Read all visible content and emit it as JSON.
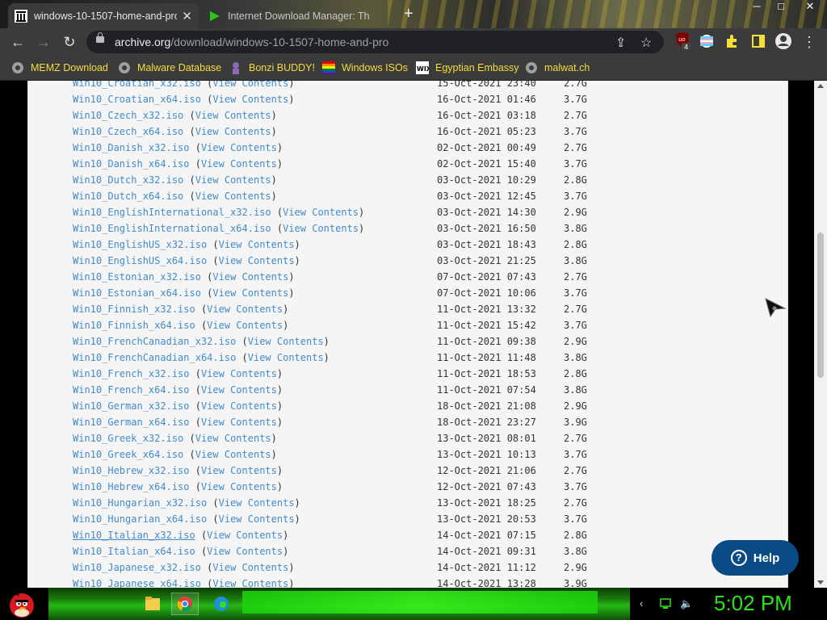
{
  "tabs": [
    {
      "title": "windows-10-1507-home-and-pro",
      "active": true
    },
    {
      "title": "Internet Download Manager: Th",
      "active": false
    }
  ],
  "window_controls": {
    "minimize": "─",
    "maximize": "□",
    "close": "✕"
  },
  "address_bar": {
    "host": "archive.org",
    "path": "/download/windows-10-1507-home-and-pro"
  },
  "extension_badge": "4",
  "bookmarks": [
    {
      "label": "MEMZ Download",
      "icon": "globe-icon"
    },
    {
      "label": "Malware Database",
      "icon": "globe-icon"
    },
    {
      "label": "Bonzi BUDDY!",
      "icon": "bonzi-icon"
    },
    {
      "label": "Windows ISOs",
      "icon": "rainbow-icon"
    },
    {
      "label": "Egyptian Embassy",
      "icon": "wix-icon"
    },
    {
      "label": "malwat.ch",
      "icon": "globe-icon"
    }
  ],
  "files": {
    "view_contents_label": "View Contents",
    "rows": [
      {
        "name": "Win10_Croatian_x32.iso",
        "date": "15-Oct-2021 23:40",
        "size": "2.7G"
      },
      {
        "name": "Win10_Croatian_x64.iso",
        "date": "16-Oct-2021 01:46",
        "size": "3.7G"
      },
      {
        "name": "Win10_Czech_x32.iso",
        "date": "16-Oct-2021 03:18",
        "size": "2.7G"
      },
      {
        "name": "Win10_Czech_x64.iso",
        "date": "16-Oct-2021 05:23",
        "size": "3.7G"
      },
      {
        "name": "Win10_Danish_x32.iso",
        "date": "02-Oct-2021 00:49",
        "size": "2.7G"
      },
      {
        "name": "Win10_Danish_x64.iso",
        "date": "02-Oct-2021 15:40",
        "size": "3.7G"
      },
      {
        "name": "Win10_Dutch_x32.iso",
        "date": "03-Oct-2021 10:29",
        "size": "2.8G"
      },
      {
        "name": "Win10_Dutch_x64.iso",
        "date": "03-Oct-2021 12:45",
        "size": "3.7G"
      },
      {
        "name": "Win10_EnglishInternational_x32.iso",
        "date": "03-Oct-2021 14:30",
        "size": "2.9G"
      },
      {
        "name": "Win10_EnglishInternational_x64.iso",
        "date": "03-Oct-2021 16:50",
        "size": "3.8G"
      },
      {
        "name": "Win10_EnglishUS_x32.iso",
        "date": "03-Oct-2021 18:43",
        "size": "2.8G"
      },
      {
        "name": "Win10_EnglishUS_x64.iso",
        "date": "03-Oct-2021 21:25",
        "size": "3.8G"
      },
      {
        "name": "Win10_Estonian_x32.iso",
        "date": "07-Oct-2021 07:43",
        "size": "2.7G"
      },
      {
        "name": "Win10_Estonian_x64.iso",
        "date": "07-Oct-2021 10:06",
        "size": "3.7G"
      },
      {
        "name": "Win10_Finnish_x32.iso",
        "date": "11-Oct-2021 13:32",
        "size": "2.7G"
      },
      {
        "name": "Win10_Finnish_x64.iso",
        "date": "11-Oct-2021 15:42",
        "size": "3.7G"
      },
      {
        "name": "Win10_FrenchCanadian_x32.iso",
        "date": "11-Oct-2021 09:38",
        "size": "2.9G"
      },
      {
        "name": "Win10_FrenchCanadian_x64.iso",
        "date": "11-Oct-2021 11:48",
        "size": "3.8G"
      },
      {
        "name": "Win10_French_x32.iso",
        "date": "11-Oct-2021 18:53",
        "size": "2.8G"
      },
      {
        "name": "Win10_French_x64.iso",
        "date": "11-Oct-2021 07:54",
        "size": "3.8G"
      },
      {
        "name": "Win10_German_x32.iso",
        "date": "18-Oct-2021 21:08",
        "size": "2.9G"
      },
      {
        "name": "Win10_German_x64.iso",
        "date": "18-Oct-2021 23:27",
        "size": "3.9G"
      },
      {
        "name": "Win10_Greek_x32.iso",
        "date": "13-Oct-2021 08:01",
        "size": "2.7G"
      },
      {
        "name": "Win10_Greek_x64.iso",
        "date": "13-Oct-2021 10:13",
        "size": "3.7G"
      },
      {
        "name": "Win10_Hebrew_x32.iso",
        "date": "12-Oct-2021 21:06",
        "size": "2.7G"
      },
      {
        "name": "Win10_Hebrew_x64.iso",
        "date": "12-Oct-2021 07:43",
        "size": "3.7G"
      },
      {
        "name": "Win10_Hungarian_x32.iso",
        "date": "13-Oct-2021 18:25",
        "size": "2.7G"
      },
      {
        "name": "Win10_Hungarian_x64.iso",
        "date": "13-Oct-2021 20:53",
        "size": "3.7G"
      },
      {
        "name": "Win10_Italian_x32.iso",
        "date": "14-Oct-2021 07:15",
        "size": "2.8G",
        "hovered": true
      },
      {
        "name": "Win10_Italian_x64.iso",
        "date": "14-Oct-2021 09:31",
        "size": "3.8G"
      },
      {
        "name": "Win10_Japanese_x32.iso",
        "date": "14-Oct-2021 11:12",
        "size": "2.9G"
      },
      {
        "name": "Win10_Japanese_x64.iso",
        "date": "14-Oct-2021 13:28",
        "size": "3.9G"
      }
    ]
  },
  "help_button": {
    "label": "Help",
    "icon": "question-icon"
  },
  "taskbar": {
    "clock": "5:02 PM"
  },
  "colors": {
    "link": "#428bca",
    "bookmark_text": "#f5dd3b",
    "help_bg": "#0a4b85",
    "clock": "#2fe31a",
    "taskbar_glow": "#26b915"
  }
}
